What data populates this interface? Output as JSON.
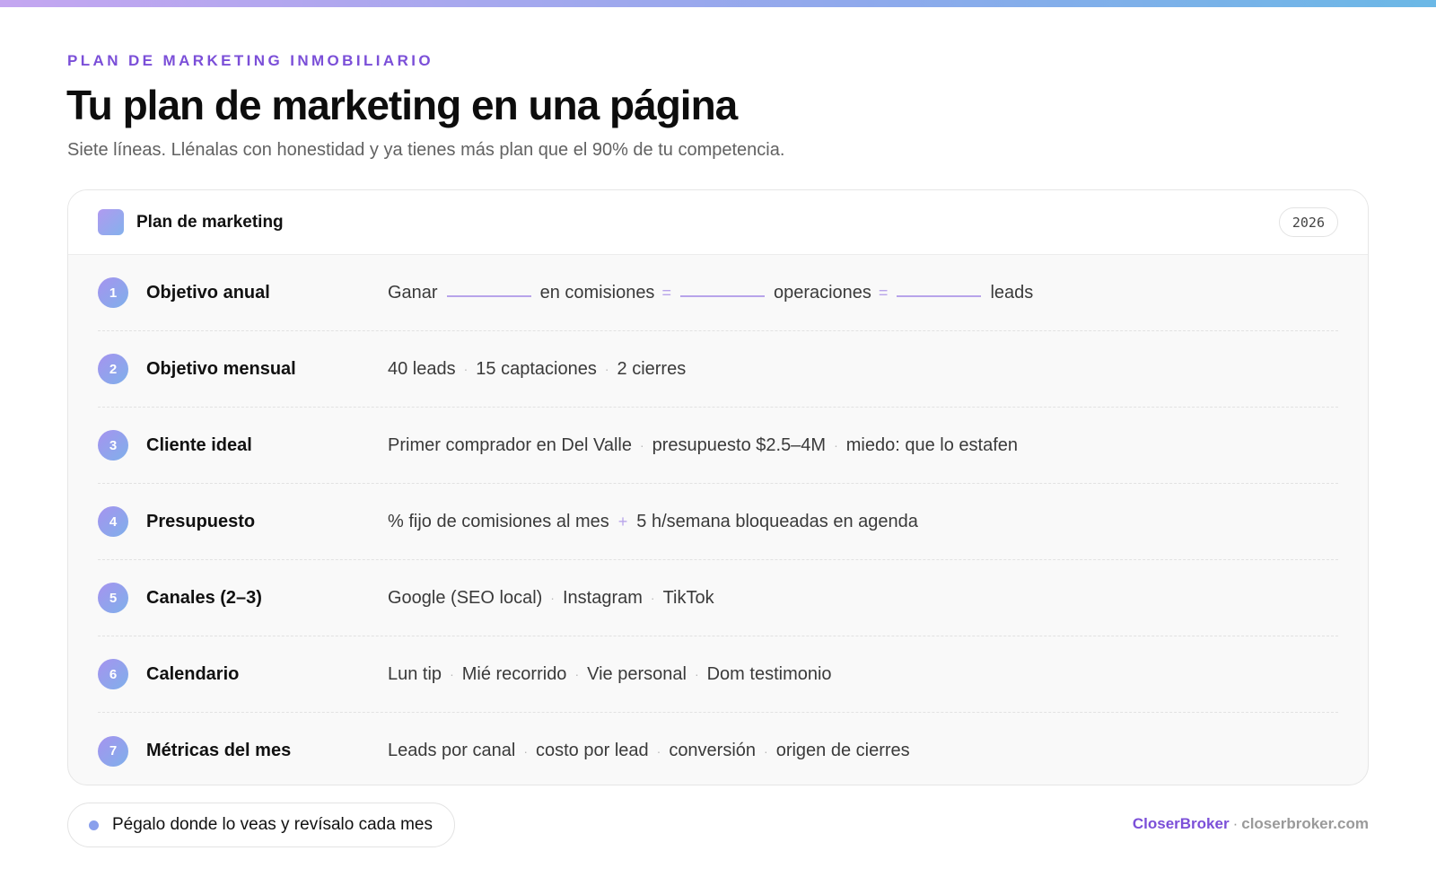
{
  "header": {
    "eyebrow": "PLAN DE MARKETING INMOBILIARIO",
    "title": "Tu plan de marketing en una página",
    "subtitle": "Siete líneas. Llénalas con honestidad y ya tienes más plan que el 90% de tu competencia."
  },
  "card": {
    "title": "Plan de marketing",
    "year": "2026"
  },
  "rows": [
    {
      "num": "1",
      "label": "Objetivo anual",
      "parts": [
        "Ganar",
        "en comisiones",
        "=",
        "operaciones",
        "=",
        "leads"
      ]
    },
    {
      "num": "2",
      "label": "Objetivo mensual",
      "items": [
        "40 leads",
        "15 captaciones",
        "2 cierres"
      ]
    },
    {
      "num": "3",
      "label": "Cliente ideal",
      "items": [
        "Primer comprador en Del Valle",
        "presupuesto $2.5–4M",
        "miedo: que lo estafen"
      ]
    },
    {
      "num": "4",
      "label": "Presupuesto",
      "items": [
        "% fijo de comisiones al mes",
        "+",
        "5 h/semana bloqueadas en agenda"
      ]
    },
    {
      "num": "5",
      "label": "Canales (2–3)",
      "items": [
        "Google (SEO local)",
        "Instagram",
        "TikTok"
      ]
    },
    {
      "num": "6",
      "label": "Calendario",
      "items": [
        "Lun tip",
        "Mié recorrido",
        "Vie personal",
        "Dom testimonio"
      ]
    },
    {
      "num": "7",
      "label": "Métricas del mes",
      "items": [
        "Leads por canal",
        "costo por lead",
        "conversión",
        "origen de cierres"
      ]
    }
  ],
  "note": "Pégalo donde lo veas y revísalo cada mes",
  "footer": {
    "brand": "CloserBroker",
    "separator": "·",
    "domain": "closerbroker.com"
  },
  "colors": {
    "accent": "#7b4fd8",
    "gradient_start": "#a693ef",
    "gradient_end": "#7fb0ea"
  }
}
